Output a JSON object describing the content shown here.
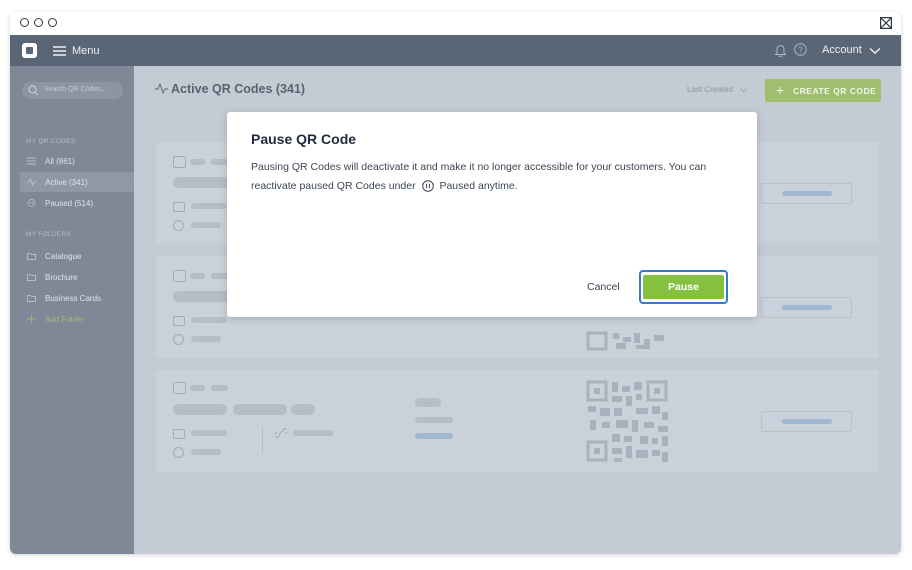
{
  "topbar": {
    "menu_label": "Menu",
    "account_label": "Account"
  },
  "sidebar": {
    "search_placeholder": "Search QR Codes...",
    "section_qr": "MY QR CODES",
    "items": [
      {
        "label": "All (861)",
        "icon": "list-icon"
      },
      {
        "label": "Active (341)",
        "icon": "pulse-icon",
        "active": true
      },
      {
        "label": "Paused (514)",
        "icon": "pause-icon"
      }
    ],
    "section_folders": "MY FOLDERS",
    "folders": [
      {
        "label": "Catalogue",
        "icon": "folder-icon"
      },
      {
        "label": "Brochure",
        "icon": "folder-icon"
      },
      {
        "label": "Business Cards",
        "icon": "folder-icon"
      }
    ],
    "add_folder": "Add Folder"
  },
  "main": {
    "title": "Active QR Codes (341)",
    "sort_label": "Last Created",
    "create_label": "CREATE QR CODE"
  },
  "modal": {
    "title": "Pause QR Code",
    "text_before": "Pausing QR Codes will deactivate it and make it no longer accessible for your customers. You can reactivate paused QR Codes under",
    "text_after": "Paused anytime.",
    "cancel_label": "Cancel",
    "pause_label": "Pause"
  },
  "colors": {
    "accent_green": "#86c03f",
    "focus_blue": "#2f7fc8",
    "topbar": "#5a6676"
  }
}
